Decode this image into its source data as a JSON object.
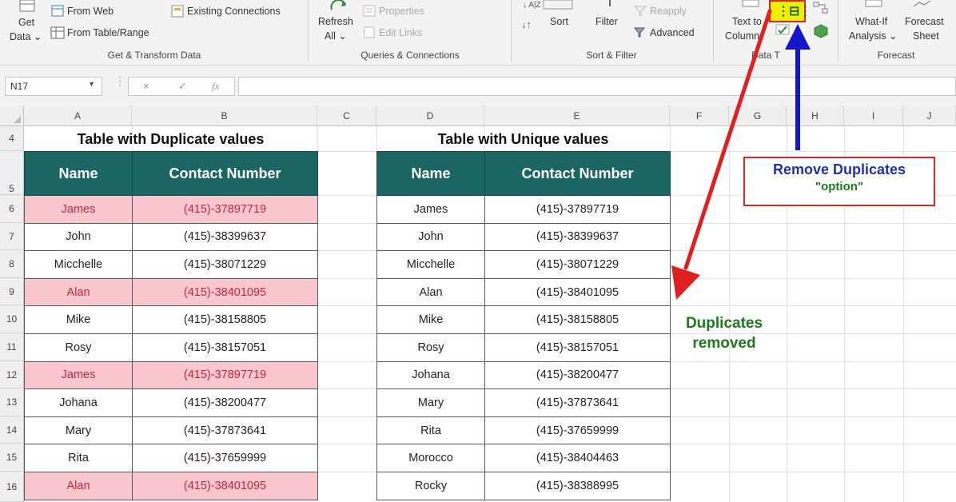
{
  "ribbon": {
    "get_data": {
      "line1": "Get",
      "line2": "Data ⌄"
    },
    "from_web": "From Web",
    "from_table": "From Table/Range",
    "existing_connections": "Existing Connections",
    "group_get_transform": "Get & Transform Data",
    "refresh": {
      "line1": "Refresh",
      "line2": "All ⌄"
    },
    "properties": "Properties",
    "edit_links": "Edit Links",
    "group_queries": "Queries & Connections",
    "sort": "Sort",
    "filter": "Filter",
    "reapply": "Reapply",
    "advanced": "Advanced",
    "group_sort_filter": "Sort & Filter",
    "text_to": {
      "line1": "Text to",
      "line2": "Column"
    },
    "group_data_tools": "Data T",
    "what_if": {
      "line1": "What-If",
      "line2": "Analysis ⌄"
    },
    "forecast_sheet": {
      "line1": "Forecast",
      "line2": "Sheet"
    },
    "group_forecast": "Forecast"
  },
  "formula_bar": {
    "name_box": "N17",
    "cancel": "×",
    "enter": "✓",
    "fx": "fx",
    "value": ""
  },
  "sheet": {
    "columns": [
      "A",
      "B",
      "C",
      "D",
      "E",
      "F",
      "G",
      "H",
      "I",
      "J"
    ],
    "rows": [
      "4",
      "5",
      "6",
      "7",
      "8",
      "9",
      "10",
      "11",
      "12",
      "13",
      "14",
      "15",
      "16"
    ]
  },
  "left_table": {
    "title": "Table with Duplicate values",
    "headers": [
      "Name",
      "Contact Number"
    ],
    "rows": [
      {
        "name": "James",
        "number": "(415)-37897719",
        "duplicate": true
      },
      {
        "name": "John",
        "number": "(415)-38399637",
        "duplicate": false
      },
      {
        "name": "Micchelle",
        "number": "(415)-38071229",
        "duplicate": false
      },
      {
        "name": "Alan",
        "number": "(415)-38401095",
        "duplicate": true
      },
      {
        "name": "Mike",
        "number": "(415)-38158805",
        "duplicate": false
      },
      {
        "name": "Rosy",
        "number": "(415)-38157051",
        "duplicate": false
      },
      {
        "name": "James",
        "number": "(415)-37897719",
        "duplicate": true
      },
      {
        "name": "Johana",
        "number": "(415)-38200477",
        "duplicate": false
      },
      {
        "name": "Mary",
        "number": "(415)-37873641",
        "duplicate": false
      },
      {
        "name": "Rita",
        "number": "(415)-37659999",
        "duplicate": false
      },
      {
        "name": "Alan",
        "number": "(415)-38401095",
        "duplicate": true
      }
    ]
  },
  "right_table": {
    "title": "Table with Unique values",
    "headers": [
      "Name",
      "Contact Number"
    ],
    "rows": [
      {
        "name": "James",
        "number": "(415)-37897719"
      },
      {
        "name": "John",
        "number": "(415)-38399637"
      },
      {
        "name": "Micchelle",
        "number": "(415)-38071229"
      },
      {
        "name": "Alan",
        "number": "(415)-38401095"
      },
      {
        "name": "Mike",
        "number": "(415)-38158805"
      },
      {
        "name": "Rosy",
        "number": "(415)-38157051"
      },
      {
        "name": "Johana",
        "number": "(415)-38200477"
      },
      {
        "name": "Mary",
        "number": "(415)-37873641"
      },
      {
        "name": "Rita",
        "number": "(415)-37659999"
      },
      {
        "name": "Morocco",
        "number": "(415)-38404463"
      },
      {
        "name": "Rocky",
        "number": "(415)-38388995"
      }
    ]
  },
  "annotations": {
    "callout_line1": "Remove Duplicates",
    "callout_line2": "\"option\"",
    "note_line1": "Duplicates",
    "note_line2": "removed"
  },
  "colors": {
    "header_fill": "#1b6562",
    "duplicate_fill": "#fbc7cf",
    "duplicate_text": "#c0283c",
    "red_arrow": "#e0201f",
    "blue_arrow": "#1316c9",
    "callout_border": "#d4292b"
  },
  "icons": [
    "get-data-icon",
    "from-web-icon",
    "from-table-icon",
    "existing-connections-icon",
    "refresh-icon",
    "properties-icon",
    "edit-links-icon",
    "sort-az-icon",
    "sort-icon",
    "filter-icon",
    "reapply-icon",
    "advanced-filter-icon",
    "text-to-columns-icon",
    "remove-duplicates-icon",
    "relationships-icon",
    "manage-data-model-icon",
    "what-if-icon",
    "forecast-sheet-icon",
    "fx-icon"
  ]
}
